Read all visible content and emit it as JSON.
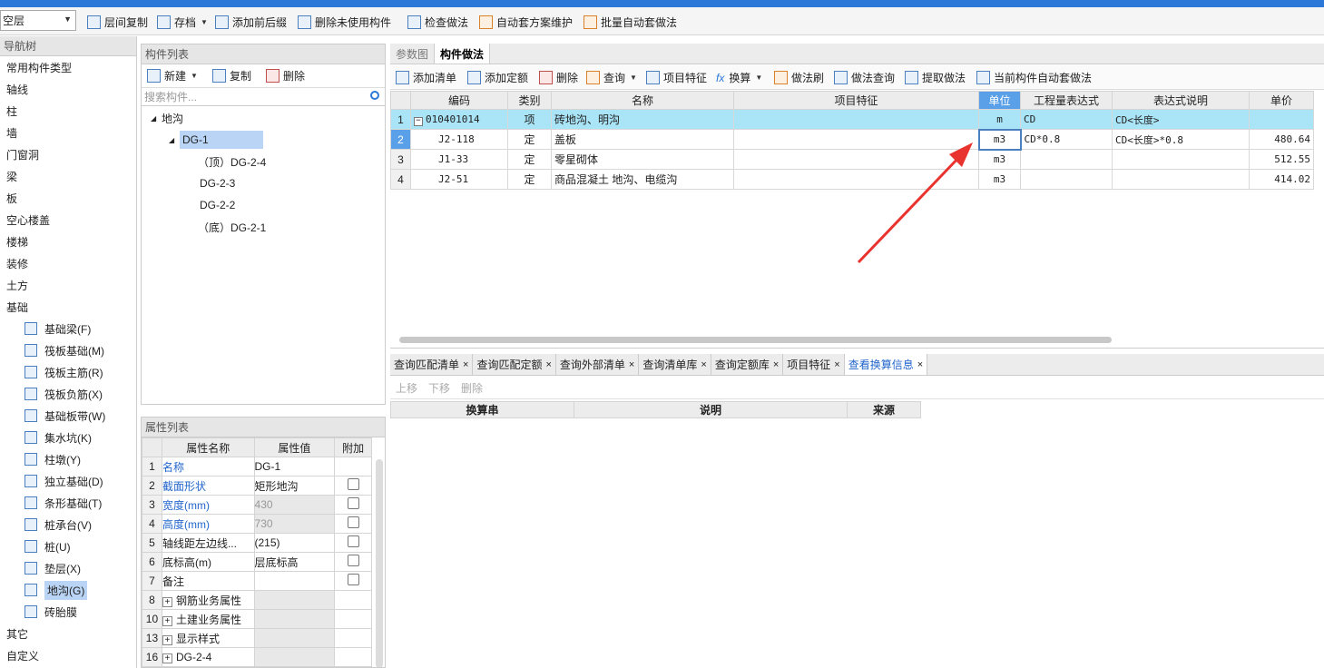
{
  "toolbar": {
    "floor_value": "空层",
    "buttons": [
      "层间复制",
      "存档",
      "添加前后缀",
      "删除未使用构件",
      "检查做法",
      "自动套方案维护",
      "批量自动套做法"
    ]
  },
  "nav": {
    "title": "导航树",
    "items": [
      "常用构件类型",
      "轴线",
      "柱",
      "墙",
      "门窗洞",
      "梁",
      "板",
      "空心楼盖",
      "楼梯",
      "装修",
      "土方",
      "基础"
    ],
    "sub_items": [
      "基础梁(F)",
      "筏板基础(M)",
      "筏板主筋(R)",
      "筏板负筋(X)",
      "基础板带(W)",
      "集水坑(K)",
      "柱墩(Y)",
      "独立基础(D)",
      "条形基础(T)",
      "桩承台(V)",
      "桩(U)",
      "垫层(X)",
      "地沟(G)",
      "砖胎膜"
    ],
    "tail_items": [
      "其它",
      "自定义"
    ]
  },
  "complist": {
    "title": "构件列表",
    "new_label": "新建",
    "copy_label": "复制",
    "delete_label": "删除",
    "search_placeholder": "搜索构件...",
    "tree": [
      "地沟",
      "DG-1",
      "（顶）DG-2-4",
      "DG-2-3",
      "DG-2-2",
      "（底）DG-2-1"
    ]
  },
  "props": {
    "title": "属性列表",
    "headers": [
      "属性名称",
      "属性值",
      "附加"
    ],
    "rows": [
      {
        "n": "1",
        "name": "名称",
        "value": "DG-1"
      },
      {
        "n": "2",
        "name": "截面形状",
        "value": "矩形地沟"
      },
      {
        "n": "3",
        "name": "宽度(mm)",
        "value": "430"
      },
      {
        "n": "4",
        "name": "高度(mm)",
        "value": "730"
      },
      {
        "n": "5",
        "name": "轴线距左边线...",
        "value": "(215)"
      },
      {
        "n": "6",
        "name": "底标高(m)",
        "value": "层底标高"
      },
      {
        "n": "7",
        "name": "备注",
        "value": ""
      },
      {
        "n": "8",
        "name": "钢筋业务属性",
        "value": ""
      },
      {
        "n": "10",
        "name": "土建业务属性",
        "value": ""
      },
      {
        "n": "13",
        "name": "显示样式",
        "value": ""
      },
      {
        "n": "16",
        "name": "DG-2-4",
        "value": ""
      }
    ]
  },
  "main": {
    "tabs": [
      "参数图",
      "构件做法"
    ],
    "buttons": [
      "添加清单",
      "添加定额",
      "删除",
      "查询",
      "项目特征",
      "换算",
      "做法刷",
      "做法查询",
      "提取做法",
      "当前构件自动套做法"
    ],
    "headers": [
      "编码",
      "类别",
      "名称",
      "项目特征",
      "单位",
      "工程量表达式",
      "表达式说明",
      "单价"
    ],
    "rows": [
      {
        "n": "1",
        "code": "010401014",
        "type": "项",
        "name": "砖地沟、明沟",
        "feature": "",
        "unit": "m",
        "expr": "CD",
        "desc": "CD<长度>",
        "price": ""
      },
      {
        "n": "2",
        "code": "J2-118",
        "type": "定",
        "name": "盖板",
        "feature": "",
        "unit": "m3",
        "expr": "CD*0.8",
        "desc": "CD<长度>*0.8",
        "price": "480.64"
      },
      {
        "n": "3",
        "code": "J1-33",
        "type": "定",
        "name": "零星砌体",
        "feature": "",
        "unit": "m3",
        "expr": "",
        "desc": "",
        "price": "512.55"
      },
      {
        "n": "4",
        "code": "J2-51",
        "type": "定",
        "name": "商品混凝土 地沟、电缆沟",
        "feature": "",
        "unit": "m3",
        "expr": "",
        "desc": "",
        "price": "414.02"
      }
    ]
  },
  "bottom": {
    "tabs": [
      "查询匹配清单",
      "查询匹配定额",
      "查询外部清单",
      "查询清单库",
      "查询定额库",
      "项目特征",
      "查看换算信息"
    ],
    "close": "×",
    "buttons": [
      "上移",
      "下移",
      "删除"
    ],
    "headers": [
      "换算串",
      "说明",
      "来源"
    ]
  },
  "colors": {
    "accent": "#2b78d8",
    "selected_row": "#a9e4f7",
    "annotation_arrow": "#e8332e"
  }
}
